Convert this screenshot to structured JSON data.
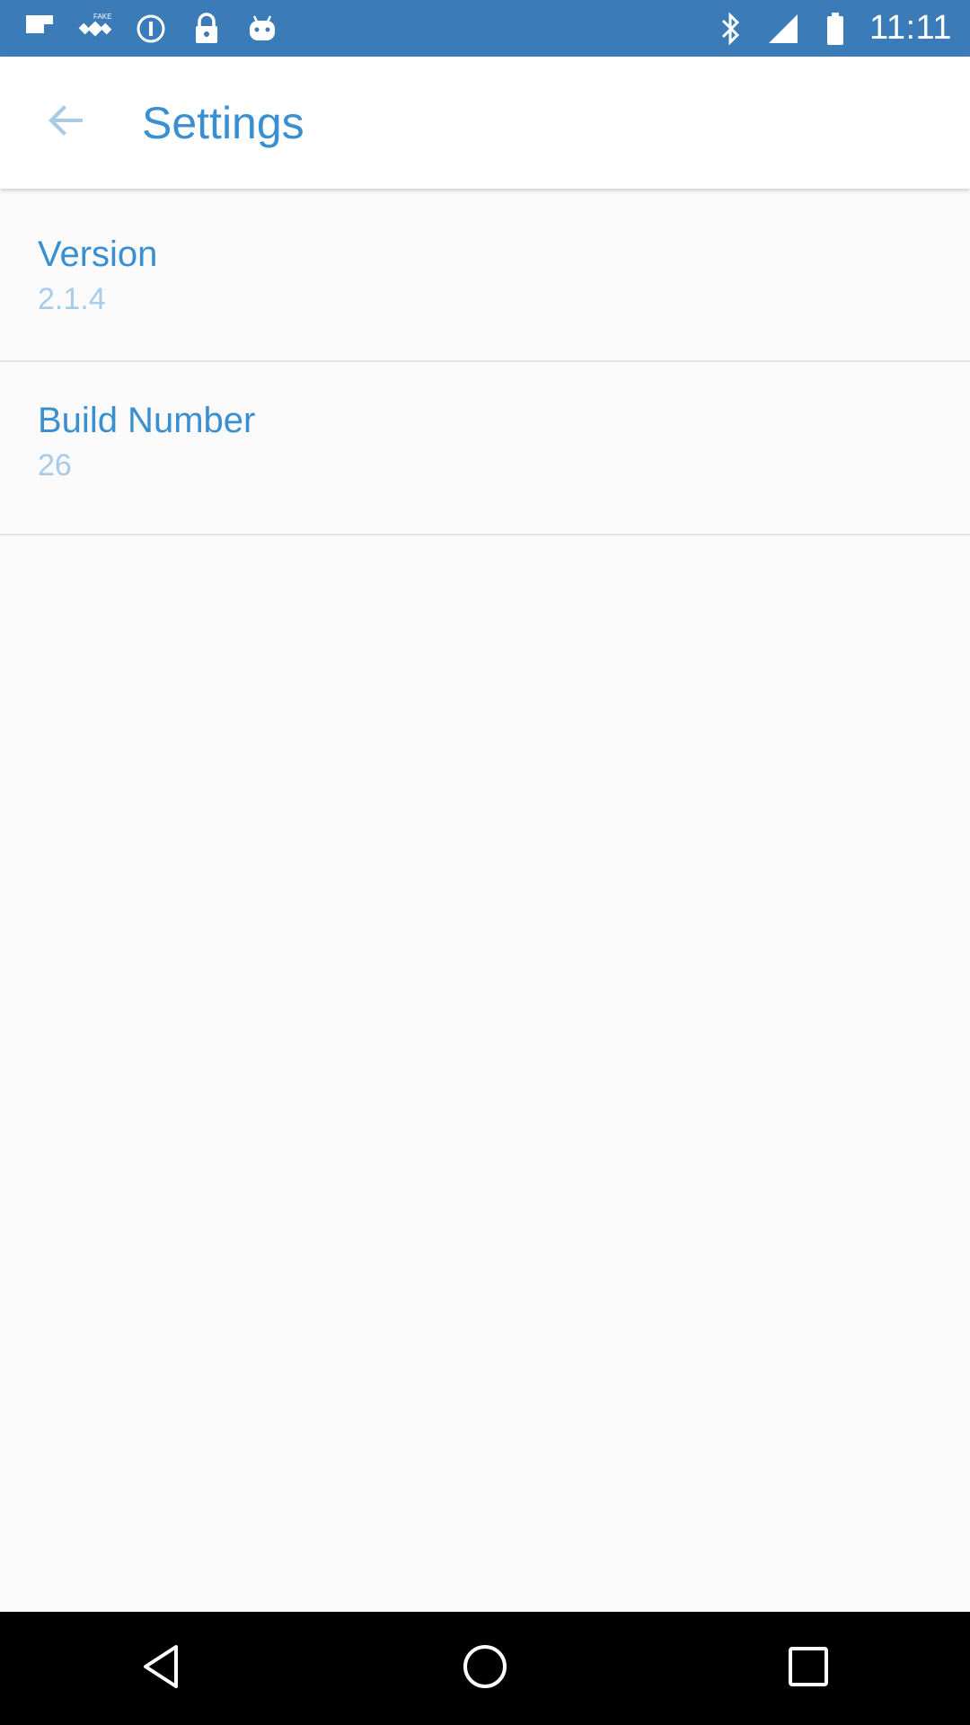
{
  "status_bar": {
    "time": "11:11",
    "icons_left": [
      "flipboard-icon",
      "fake-gps-icon",
      "info-icon",
      "lock-icon",
      "android-icon"
    ],
    "icons_right": [
      "bluetooth-icon",
      "signal-icon",
      "battery-icon"
    ]
  },
  "app_bar": {
    "title": "Settings",
    "back_icon": "arrow-back-icon"
  },
  "settings": [
    {
      "title": "Version",
      "value": "2.1.4"
    },
    {
      "title": "Build Number",
      "value": "26"
    }
  ],
  "nav_bar": {
    "buttons": [
      "back-triangle-icon",
      "home-circle-icon",
      "recents-square-icon"
    ]
  },
  "colors": {
    "status_bar": "#3a7bb8",
    "accent": "#3a8fd1",
    "secondary_text": "#a8cce8",
    "background": "#fafafa"
  }
}
